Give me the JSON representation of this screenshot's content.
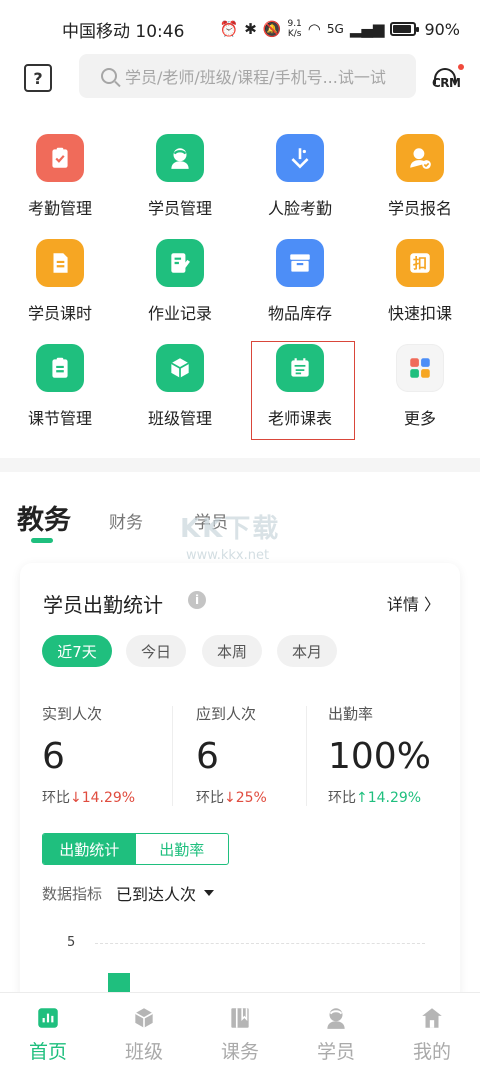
{
  "status_bar": {
    "carrier_time": "中国移动 10:46",
    "speed_value": "9.1",
    "speed_unit": "K/s",
    "network": "5G",
    "battery": "90%"
  },
  "search": {
    "placeholder": "学员/老师/班级/课程/手机号...试一试",
    "help_icon": "?",
    "crm_label": "CRM"
  },
  "grid": [
    {
      "label": "考勤管理",
      "icon": "clipboard-check-icon",
      "color": "#f06b5a"
    },
    {
      "label": "学员管理",
      "icon": "student-icon",
      "color": "#1fbf7e"
    },
    {
      "label": "人脸考勤",
      "icon": "face-attendance-icon",
      "color": "#4d8ef7"
    },
    {
      "label": "学员报名",
      "icon": "student-signup-icon",
      "color": "#f6a623"
    },
    {
      "label": "学员课时",
      "icon": "document-icon",
      "color": "#f6a623"
    },
    {
      "label": "作业记录",
      "icon": "homework-icon",
      "color": "#1fbf7e"
    },
    {
      "label": "物品库存",
      "icon": "inventory-icon",
      "color": "#4d8ef7"
    },
    {
      "label": "快速扣课",
      "icon": "deduct-icon",
      "color": "#f6a623"
    },
    {
      "label": "课节管理",
      "icon": "lesson-icon",
      "color": "#1fbf7e"
    },
    {
      "label": "班级管理",
      "icon": "cube-icon",
      "color": "#1fbf7e"
    },
    {
      "label": "老师课表",
      "icon": "calendar-icon",
      "color": "#1fbf7e"
    },
    {
      "label": "更多",
      "icon": "more-icon",
      "color": "#f5f5f5"
    }
  ],
  "deduct_glyph": "扣",
  "tabs": [
    "教务",
    "财务",
    "学员"
  ],
  "watermark": {
    "text": "KK下载",
    "sub": "www.kkx.net"
  },
  "card": {
    "title": "学员出勤统计",
    "info": "i",
    "detail": "详情 〉",
    "chips": [
      "近7天",
      "今日",
      "本周",
      "本月"
    ],
    "stats": [
      {
        "label": "实到人次",
        "value": "6",
        "compare_prefix": "环比",
        "compare_value": "↓14.29%",
        "direction": "down"
      },
      {
        "label": "应到人次",
        "value": "6",
        "compare_prefix": "环比",
        "compare_value": "↓25%",
        "direction": "down"
      },
      {
        "label": "出勤率",
        "value": "100%",
        "compare_prefix": "环比",
        "compare_value": "↑14.29%",
        "direction": "up"
      }
    ],
    "toggle": [
      "出勤统计",
      "出勤率"
    ],
    "metric_label": "数据指标",
    "metric_value": "已到达人次",
    "y_tick": "5"
  },
  "bottom_nav": [
    {
      "label": "首页",
      "icon": "home-chart-icon",
      "active": true
    },
    {
      "label": "班级",
      "icon": "class-cube-icon",
      "active": false
    },
    {
      "label": "课务",
      "icon": "course-book-icon",
      "active": false
    },
    {
      "label": "学员",
      "icon": "student-nav-icon",
      "active": false
    },
    {
      "label": "我的",
      "icon": "mine-house-icon",
      "active": false
    }
  ],
  "colors": {
    "accent": "#1fbf7e",
    "down": "#e04c3f",
    "highlight": "#d9463a"
  }
}
